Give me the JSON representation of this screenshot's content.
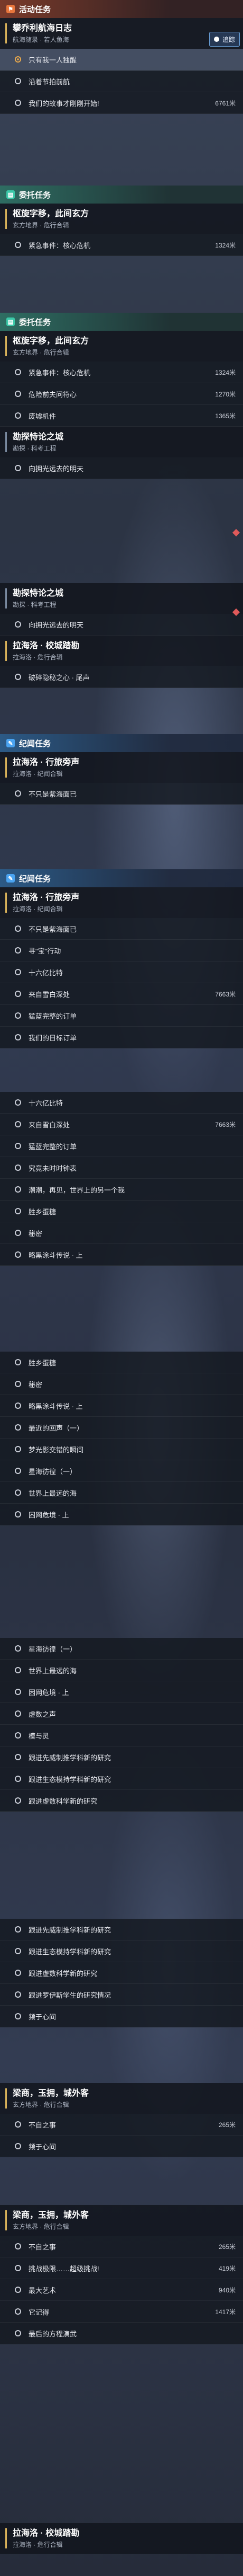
{
  "sections": {
    "activity": {
      "title": "活动任务",
      "icon": "flag-icon"
    },
    "daily": {
      "title": "委托任务",
      "icon": "scroll-icon"
    },
    "story": {
      "title": "纪闻任务",
      "icon": "book-icon"
    }
  },
  "track_button": {
    "label": "追踪"
  },
  "quests": {
    "q1": {
      "title": "攀乔利航海日志",
      "sub": "航海随录 · 若人鱼海"
    },
    "q2": {
      "title": "枢旋字移，此间玄方",
      "sub": "玄方地界 · 危行合辑"
    },
    "q3": {
      "title": "勘探恃论之城",
      "sub": "勘探 · 科考工程"
    },
    "q4": {
      "title": "拉海洛 · 校城踏勘",
      "sub": "拉海洛 · 危行合辑"
    },
    "q5": {
      "title": "拉海洛 · 行旅旁声",
      "sub": "拉海洛 · 纪闻合辑"
    },
    "q6": {
      "title": "梁商，玉拥，城外客",
      "sub": "玄方地界 · 危行合辑"
    }
  },
  "rows": {
    "r1": "只有我一人独醒",
    "r2": "沿着节拍前航",
    "r3": "我们的故事才刚刚开始!",
    "r3d": "6761米",
    "r4": "紧急事件：核心危机",
    "r4d": "1324米",
    "r5": "紧急事件：核心危机",
    "r5d": "1324米",
    "r6": "危险前夫问符心",
    "r6d": "1270米",
    "r7": "废墟机件",
    "r7d": "1365米",
    "r8": "向拥光远去的明天",
    "r9": "向拥光远去的明天",
    "r10": "破碎隐秘之心 · 尾声",
    "r11": "不只是紫海面已",
    "r12": "不只是紫海面已",
    "r13": "寻\"宝\"行动",
    "r14": "十六亿比特",
    "r15": "来自雪白深处",
    "r15d": "7663米",
    "r16": "猛蓝完整的订单",
    "r17": "我们的日标订单",
    "r18": "十六亿比特",
    "r19": "来自雪白深处",
    "r19d": "7663米",
    "r20": "猛蓝完整的订单",
    "r21": "究竟未时时钟表",
    "r22": "潮潮，再见，世界上的另一个我",
    "r23": "胜乡蛋糖",
    "r24": "秘密",
    "r25": "略黑涂斗传说 · 上",
    "r26": "胜乡蛋糖",
    "r27": "秘密",
    "r28": "略黑涂斗传说 · 上",
    "r29": "最近的回声（一）",
    "r30": "梦光影交错的瞬间",
    "r31": "星海彷徨（一）",
    "r32": "世界上最远的海",
    "r33": "困网危境 · 上",
    "r34": "星海彷徨（一）",
    "r35": "世界上最远的海",
    "r36": "困网危境 · 上",
    "r37": "虚数之声",
    "r38": "模与灵",
    "r39": "跟进先威制推学科新的研究",
    "r40": "跟进生态模持学科新的研究",
    "r41": "跟进虚数科学新的研究",
    "r42": "跟进先威制推学科新的研究",
    "r43": "跟进生态模持学科新的研究",
    "r44": "跟进虚数科学新的研究",
    "r45": "跟进罗伊斯学生的研究情况",
    "r46": "频于心间",
    "r47": "不自之事",
    "r47d": "265米",
    "r48": "频于心间",
    "r49": "不自之事",
    "r49d": "265米",
    "r50": "挑战极限……超级挑战!",
    "r50d": "419米",
    "r51": "最大艺术",
    "r51d": "940米",
    "r52": "它记得",
    "r52d": "1417米",
    "r53": "最后的方程演武"
  }
}
